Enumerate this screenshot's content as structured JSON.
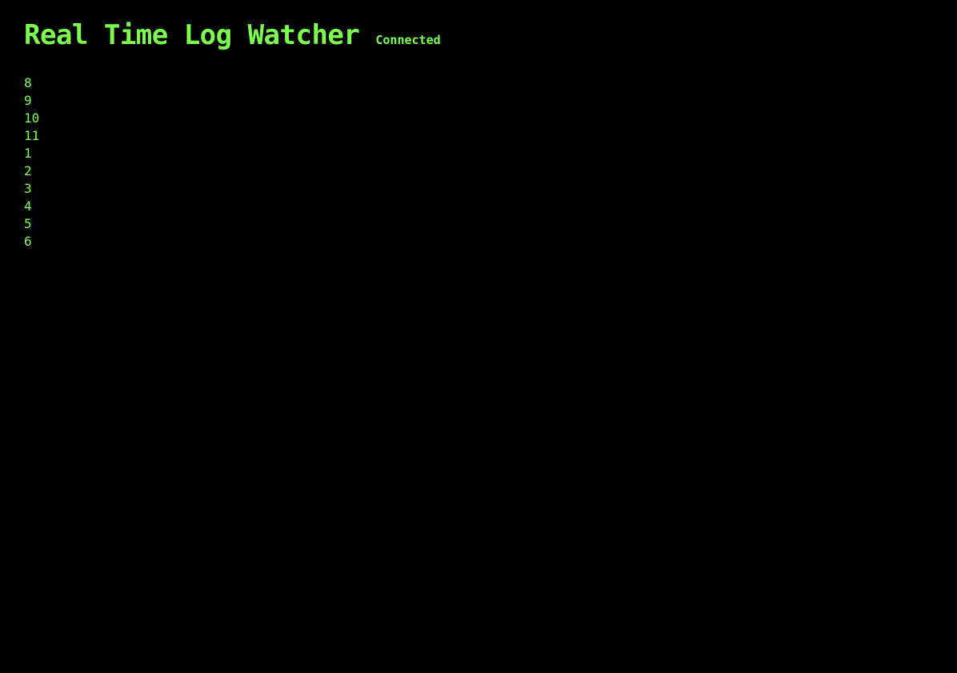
{
  "header": {
    "title": "Real Time Log Watcher",
    "status": "Connected"
  },
  "log": {
    "lines": [
      "8",
      "9",
      "10",
      "11",
      "1",
      "2",
      "3",
      "4",
      "5",
      "6"
    ]
  },
  "colors": {
    "background": "#000000",
    "text": "#7cff4f"
  }
}
